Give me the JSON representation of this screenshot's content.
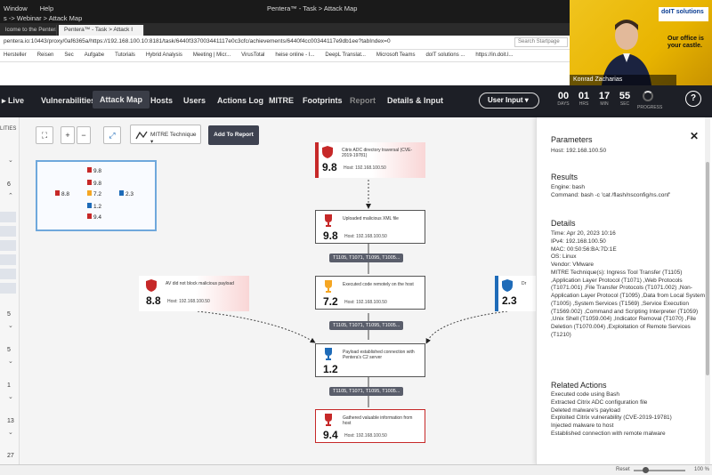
{
  "os": {
    "menu": [
      "Window",
      "Help"
    ],
    "path": "s -> Webinar > Attack Map",
    "title": "Pentera™ - Task > Attack Map"
  },
  "tabs": [
    "lcome to the Pentera Pl",
    "Pentera™ - Task > Attack I"
  ],
  "address": {
    "url": "pentera.io:10443/proxy/0af6365a/https://192.168.100.10:8181/task/6440f337003441117e0c3cfc/achievements/6440f4cc00344117e9db1ee?tabIndex=0",
    "search_placeholder": "Search Startpage"
  },
  "bookmarks": [
    "Hersteller",
    "Reisen",
    "Sec",
    "Aufgabe",
    "Tutorials",
    "Hybrid Analysis",
    "Meeting | Micr...",
    "VirusTotal",
    "heise online - I...",
    "DeepL Translat...",
    "Microsoft Teams",
    "doIT solutions ...",
    "https://in.doit.l..."
  ],
  "webcam": {
    "logo": "doIT solutions",
    "tagline": "Our office is your castle.",
    "name": "Konrad Zacharias"
  },
  "nav": {
    "items": [
      "Live",
      "Vulnerabilities",
      "Attack Map",
      "Hosts",
      "Users",
      "Actions Log",
      "MITRE",
      "Footprints",
      "Report",
      "Details & Input"
    ],
    "active": "Attack Map",
    "user_input": "User Input",
    "timer": [
      {
        "value": "00",
        "label": "DAYS"
      },
      {
        "value": "01",
        "label": "HRS"
      },
      {
        "value": "17",
        "label": "MIN"
      },
      {
        "value": "55",
        "label": "SEC"
      }
    ],
    "progress_label": "PROGRESS",
    "help": "?"
  },
  "leftcol": {
    "header": "LITIES",
    "numbers": [
      "6",
      "5",
      "5",
      "1",
      "13",
      "27"
    ]
  },
  "toolbar": {
    "mitre_label": "MITRE Technique",
    "add_report": "Add To Report"
  },
  "minimap": {
    "items": [
      {
        "score": "9.8",
        "color": "#c62828"
      },
      {
        "score": "9.8",
        "color": "#c62828"
      },
      {
        "score": "8.8",
        "color": "#c62828"
      },
      {
        "score": "7.2",
        "color": "#f5a623"
      },
      {
        "score": "2.3",
        "color": "#1e6bb8"
      },
      {
        "score": "1.2",
        "color": "#1e6bb8"
      },
      {
        "score": "9.4",
        "color": "#c62828"
      }
    ]
  },
  "nodes": {
    "citrix": {
      "score": "9.8",
      "desc": "Citrix ADC directory traversal (CVE-2019-19781)",
      "host": "192.168.100.50"
    },
    "upload": {
      "score": "9.8",
      "desc": "Uploaded malicious XML file",
      "host": "192.168.100.50"
    },
    "av": {
      "score": "8.8",
      "desc": "AV did not block malicious payload",
      "host": "192.168.100.50"
    },
    "exec": {
      "score": "7.2",
      "desc": "Executed code remotely on the host",
      "host": "192.168.100.50"
    },
    "dr": {
      "score": "2.3",
      "desc": "Dr",
      "host": ""
    },
    "payload": {
      "score": "1.2",
      "desc": "Payload established connection with Pentera's C2 server",
      "host": "192.168.100.50"
    },
    "gather": {
      "score": "9.4",
      "desc": "Gathered valuable information from host",
      "host": "192.168.100.50"
    },
    "host_prefix": "Host:"
  },
  "pills": [
    "T1105, T1071, T1095, T1005...",
    "T1105, T1071, T1095, T1005...",
    "T1105, T1071, T1095, T1005..."
  ],
  "panel": {
    "params_title": "Parameters",
    "params_text": "Host: 192.168.100.50",
    "results_title": "Results",
    "results_text": "Engine: bash\nCommand: bash -c 'cat /flash/nsconfig/ns.conf'",
    "details_title": "Details",
    "details_text": "Time: Apr 20, 2023 10:16\nIPv4: 192.168.100.50\nMAC: 00:50:56:BA:7D:1E\nOS: Linux\nVendor: VMware\nMITRE Technique(s): Ingress Tool Transfer (T1105) ,Application Layer Protocol (T1071) ,Web Protocols (T1071.001) ,File Transfer Protocols (T1071.002) ,Non-Application Layer Protocol (T1095) ,Data from Local System (T1005) ,System Services (T1569) ,Service Execution (T1569.002) ,Command and Scripting Interpreter (T1059) ,Unix Shell (T1059.004) ,Indicator Removal (T1070) ,File Deletion (T1070.004) ,Exploitation of Remote Services (T1210)",
    "actions_title": "Related Actions",
    "actions_text": "Executed code using Bash\nExtracted Citrix ADC configuration file\nDeleted malware's payload\nExploited Citrix vulnerability (CVE-2019-19781)\nInjected malware to host\nEstablished connection with remote malware"
  },
  "status": {
    "reset": "Reset",
    "zoom": "100 %"
  },
  "colors": {
    "critical": "#c62828",
    "medium": "#f5a623",
    "low": "#1e6bb8",
    "nav_bg": "#1d1f26"
  }
}
